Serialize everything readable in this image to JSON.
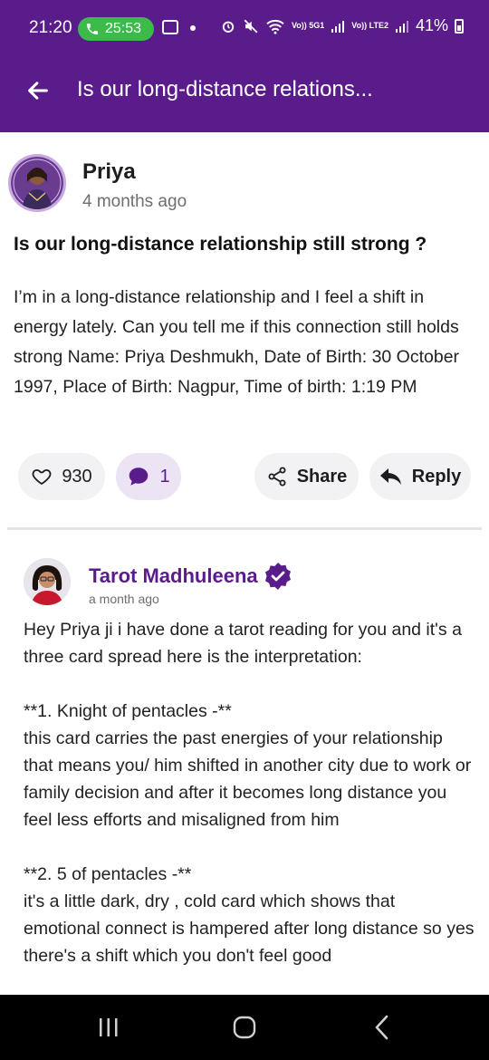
{
  "status_bar": {
    "time": "21:20",
    "call_timer": "25:53",
    "network_label_1": "Vo)) 5G1",
    "network_label_2": "Vo)) LTE2",
    "battery": "41%"
  },
  "app_bar": {
    "title": "Is our long-distance relations..."
  },
  "post": {
    "author": "Priya",
    "time": "4 months ago",
    "title": "Is our long-distance relationship still strong ?",
    "body": "I’m in a long-distance relationship and I feel a shift in energy lately. Can you tell me if this connection still holds strong Name: Priya Deshmukh, Date of Birth: 30 October 1997, Place of Birth: Nagpur, Time of birth: 1:19 PM"
  },
  "actions": {
    "likes": "930",
    "comments": "1",
    "share_label": "Share",
    "reply_label": "Reply"
  },
  "comment": {
    "author": "Tarot Madhuleena",
    "time": "a month ago",
    "text": "Hey Priya ji i have done a tarot reading for you and it's a three card spread here is the interpretation:\n\n**1. Knight of pentacles -**\n this card carries the past energies of your relationship that means you/ him shifted in another city due to work or family decision and after it becomes long distance you feel less efforts and misaligned from him\n\n**2. 5 of pentacles -**\n it's a little dark, dry , cold card which shows that emotional connect is hampered after long distance so yes there's a shift which you don't feel good"
  },
  "colors": {
    "brand_purple": "#5b1c8b",
    "call_green": "#3dbb4a",
    "verified_badge": "#5b1c8b"
  },
  "icons": [
    "back-arrow-icon",
    "heart-icon",
    "comment-bubble-icon",
    "share-icon",
    "reply-icon",
    "verified-badge-icon",
    "recents-icon",
    "home-icon",
    "nav-back-icon"
  ]
}
